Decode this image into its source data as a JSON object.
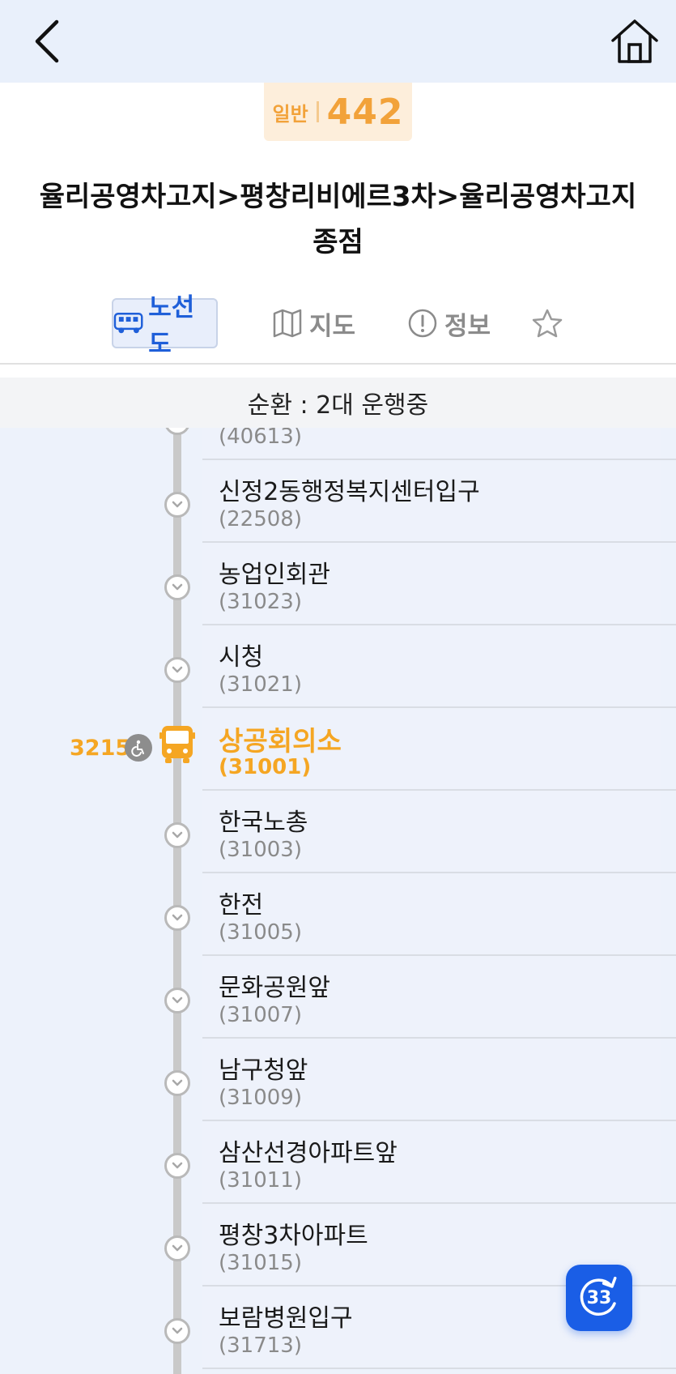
{
  "header": {
    "back_icon": "chevron-left-icon",
    "home_icon": "home-icon"
  },
  "route": {
    "type": "일반",
    "number": "442",
    "title_line1": "율리공영차고지>평창리비에르3차>율리공영차고지",
    "title_line2": "종점"
  },
  "tabs": [
    {
      "label": "노선도",
      "icon": "bus-icon",
      "active": true
    },
    {
      "label": "지도",
      "icon": "map-icon",
      "active": false
    },
    {
      "label": "정보",
      "icon": "info-icon",
      "active": false
    },
    {
      "label": "",
      "icon": "star-icon",
      "active": false
    }
  ],
  "status": "순환 : 2대 운행중",
  "stops": [
    {
      "name": "",
      "id": "(40613)",
      "current": false
    },
    {
      "name": "신정2동행정복지센터입구",
      "id": "(22508)",
      "current": false
    },
    {
      "name": "농업인회관",
      "id": "(31023)",
      "current": false
    },
    {
      "name": "시청",
      "id": "(31021)",
      "current": false
    },
    {
      "name": "상공회의소",
      "id": "(31001)",
      "current": true,
      "bus_number": "3215",
      "low_floor": true
    },
    {
      "name": "한국노총",
      "id": "(31003)",
      "current": false
    },
    {
      "name": "한전",
      "id": "(31005)",
      "current": false
    },
    {
      "name": "문화공원앞",
      "id": "(31007)",
      "current": false
    },
    {
      "name": "남구청앞",
      "id": "(31009)",
      "current": false
    },
    {
      "name": "삼산선경아파트앞",
      "id": "(31011)",
      "current": false
    },
    {
      "name": "평창3차아파트",
      "id": "(31015)",
      "current": false
    },
    {
      "name": "보람병원입구",
      "id": "(31713)",
      "current": false
    }
  ],
  "refresh": {
    "count": "33",
    "icon": "refresh-icon"
  },
  "colors": {
    "accent_orange": "#f5a623",
    "accent_blue": "#1a5ee6",
    "header_bg": "#e9f0fb"
  }
}
